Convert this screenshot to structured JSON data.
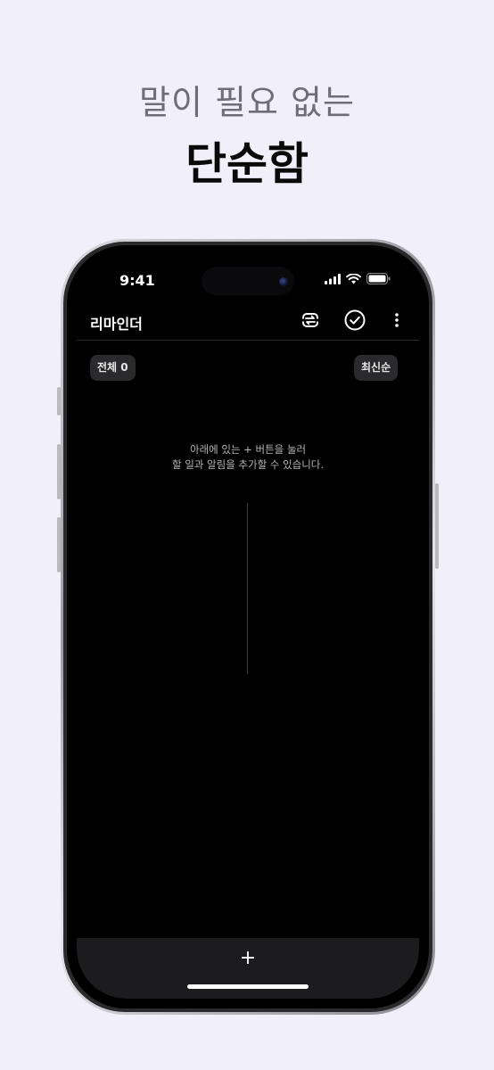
{
  "promo": {
    "subtitle": "말이 필요 없는",
    "title": "단순함"
  },
  "status_bar": {
    "time": "9:41"
  },
  "app": {
    "title": "리마인더",
    "icons": [
      "swap-icon",
      "check-circle-icon",
      "more-vertical-icon"
    ]
  },
  "filters": {
    "all_label": "전체 0",
    "sort_label": "최신순"
  },
  "empty_state": {
    "line1": "아래에 있는 + 버튼을 눌러",
    "line2": "할 일과 알림을 추가할 수 있습니다."
  },
  "bottom_bar": {
    "add_label": "+"
  },
  "colors": {
    "background": "#f1f0fa",
    "screen": "#000000",
    "chip": "#2a2a2c",
    "bottom_bar": "#1c1c1e"
  }
}
